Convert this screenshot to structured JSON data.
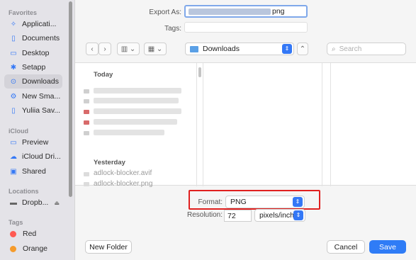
{
  "sidebar": {
    "favorites_header": "Favorites",
    "favorites": [
      {
        "label": "Applicati...",
        "icon": "applications-icon"
      },
      {
        "label": "Documents",
        "icon": "document-icon"
      },
      {
        "label": "Desktop",
        "icon": "desktop-icon"
      },
      {
        "label": "Setapp",
        "icon": "setapp-icon"
      },
      {
        "label": "Downloads",
        "icon": "downloads-icon",
        "active": true
      },
      {
        "label": "New Sma...",
        "icon": "gear-icon"
      },
      {
        "label": "Yuliia Sav...",
        "icon": "document-icon"
      }
    ],
    "icloud_header": "iCloud",
    "icloud": [
      {
        "label": "Preview",
        "icon": "folder-icon"
      },
      {
        "label": "iCloud Dri...",
        "icon": "cloud-icon"
      },
      {
        "label": "Shared",
        "icon": "shared-folder-icon"
      }
    ],
    "locations_header": "Locations",
    "locations": [
      {
        "label": "Dropb...",
        "icon": "drive-icon"
      }
    ],
    "tags_header": "Tags",
    "tags": [
      {
        "label": "Red",
        "color": "#ff5a52"
      },
      {
        "label": "Orange",
        "color": "#f59b2b"
      }
    ]
  },
  "export": {
    "export_as_label": "Export As:",
    "filename_suffix": "png",
    "tags_label": "Tags:"
  },
  "toolbar": {
    "back": "‹",
    "forward": "›",
    "location": "Downloads",
    "search_placeholder": "Search"
  },
  "files": {
    "today_header": "Today",
    "yesterday_header": "Yesterday",
    "yesterday_items": [
      "adlock-blocker.avif",
      "adlock-blocker.png"
    ]
  },
  "options": {
    "format_label": "Format:",
    "format_value": "PNG",
    "resolution_label": "Resolution:",
    "resolution_value": "72",
    "resolution_unit": "pixels/inch"
  },
  "buttons": {
    "new_folder": "New Folder",
    "cancel": "Cancel",
    "save": "Save"
  },
  "colors": {
    "accent": "#2f7cf6",
    "highlight": "#e0201f"
  }
}
